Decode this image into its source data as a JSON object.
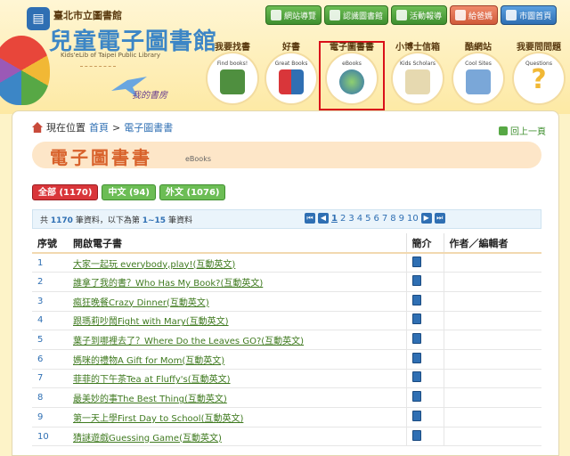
{
  "header": {
    "library_name": "臺北市立圖書館",
    "site_title": "兒童電子圖書館",
    "site_subtitle": "Kids'eLib of Taipei Public Library",
    "deco_text": "我的書房"
  },
  "top_links": [
    {
      "label": "網站導覽",
      "icon": "map-icon"
    },
    {
      "label": "認識圖書館",
      "icon": "library-icon"
    },
    {
      "label": "活動報導",
      "icon": "news-icon"
    },
    {
      "label": "給爸媽",
      "icon": "parents-icon"
    },
    {
      "label": "市圖首頁",
      "icon": "home-icon"
    }
  ],
  "nav": [
    {
      "label": "我要找書",
      "en": "Find books!"
    },
    {
      "label": "好書",
      "en": "Great Books"
    },
    {
      "label": "電子圖書書",
      "en": "eBooks"
    },
    {
      "label": "小博士信箱",
      "en": "Kids Scholars"
    },
    {
      "label": "酷網站",
      "en": "Cool Sites"
    },
    {
      "label": "我要問問題",
      "en": "Questions"
    }
  ],
  "breadcrumb": {
    "prefix": "現在位置",
    "home": "首頁",
    "sep": ">",
    "current": "電子圖書書"
  },
  "back_label": "回上一頁",
  "page_title": "電子圖書書",
  "page_title_en": "eBooks",
  "filters": [
    {
      "label": "全部 (1170)",
      "active": true
    },
    {
      "label": "中文 (94)",
      "active": false
    },
    {
      "label": "外文 (1076)",
      "active": false
    }
  ],
  "summary": {
    "pre": "共",
    "total": "1170",
    "mid": "筆資料，以下為第",
    "from": "1",
    "dash": "~",
    "to": "15",
    "post": "筆資料"
  },
  "pager": {
    "pages": [
      "1",
      "2",
      "3",
      "4",
      "5",
      "6",
      "7",
      "8",
      "9",
      "10"
    ],
    "current": "1"
  },
  "table": {
    "headers": {
      "num": "序號",
      "title": "開啟電子書",
      "intro": "簡介",
      "author": "作者／編輯者"
    },
    "rows": [
      {
        "num": "1",
        "title": "大家一起玩 everybody,play!(互動英文)"
      },
      {
        "num": "2",
        "title": "誰拿了我的書？Who Has My Book?(互動英文)"
      },
      {
        "num": "3",
        "title": "瘋狂晚餐Crazy Dinner(互動英文)"
      },
      {
        "num": "4",
        "title": "跟瑪莉吵鬧Fight with Mary(互動英文)"
      },
      {
        "num": "5",
        "title": "葉子到哪裡去了？Where Do the Leaves GO?(互動英文)"
      },
      {
        "num": "6",
        "title": "媽咪的禮物A Gift for Mom(互動英文)"
      },
      {
        "num": "7",
        "title": "菲菲的下午茶Tea at Fluffy's(互動英文)"
      },
      {
        "num": "8",
        "title": "最美妙的事The Best Thing(互動英文)"
      },
      {
        "num": "9",
        "title": "第一天上學First Day to School(互動英文)"
      },
      {
        "num": "10",
        "title": "猜謎遊戲Guessing Game(互動英文)"
      }
    ]
  },
  "colors": {
    "accent_green": "#3f8f2f",
    "accent_red": "#d9101a",
    "title_orange": "#d8612a",
    "link_blue": "#2f6fb3"
  }
}
